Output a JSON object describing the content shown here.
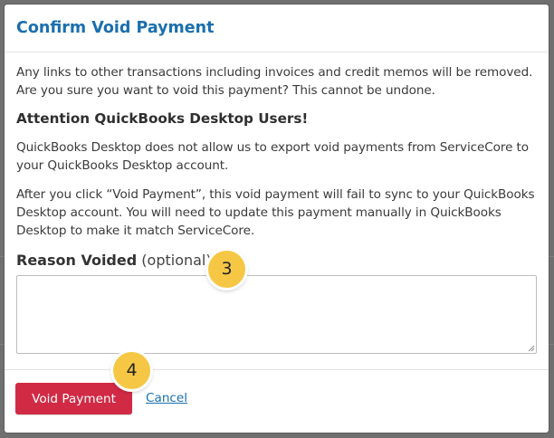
{
  "modal": {
    "title": "Confirm Void Payment",
    "intro": "Any links to other transactions including invoices and credit memos will be removed. Are you sure you want to void this payment? This cannot be undone.",
    "attention_heading": "Attention QuickBooks Desktop Users!",
    "attention_p1": "QuickBooks Desktop does not allow us to export void payments from ServiceCore to your QuickBooks Desktop account.",
    "attention_p2": "After you click “Void Payment”, this void payment will fail to sync to your QuickBooks Desktop account. You will need to update this payment manually in QuickBooks Desktop to make it match ServiceCore.",
    "reason_label": "Reason Voided",
    "reason_optional": "(optional)",
    "reason_value": "",
    "void_button": "Void Payment",
    "cancel_link": "Cancel"
  },
  "callouts": {
    "step_reason": "3",
    "step_void": "4"
  },
  "colors": {
    "title": "#1a6fae",
    "void_button": "#d12a45",
    "badge": "#f6c744",
    "overlay": "#6f6f6f"
  }
}
